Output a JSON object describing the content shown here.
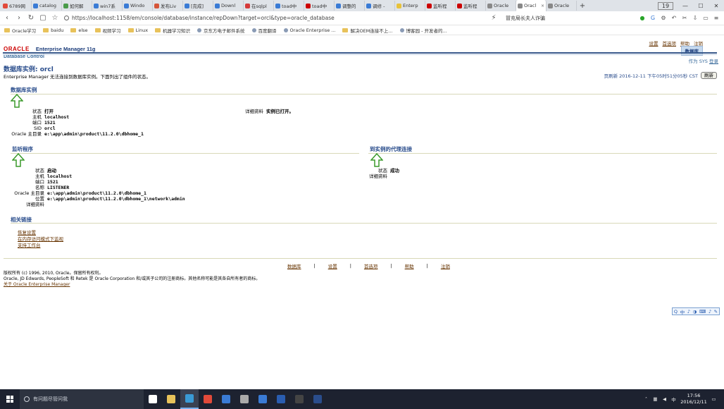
{
  "browser": {
    "tabs": [
      {
        "label": "6789网",
        "color": "#e24a3a",
        "active": false
      },
      {
        "label": "catalog",
        "color": "#3a7bd5",
        "active": false
      },
      {
        "label": "如何解",
        "color": "#4a9b4a",
        "active": false
      },
      {
        "label": "win7系",
        "color": "#3a7bd5",
        "active": false
      },
      {
        "label": "Windo",
        "color": "#3a7bd5",
        "active": false
      },
      {
        "label": "发布Liv",
        "color": "#d5553a",
        "active": false
      },
      {
        "label": "[完成]",
        "color": "#3a7bd5",
        "active": false
      },
      {
        "label": "Downl",
        "color": "#3a7bd5",
        "active": false
      },
      {
        "label": "在sqlpl",
        "color": "#d53a3a",
        "active": false
      },
      {
        "label": "toad中",
        "color": "#3a7bd5",
        "active": false
      },
      {
        "label": "toad中",
        "color": "#cc0000",
        "active": false
      },
      {
        "label": "调整的",
        "color": "#3a7bd5",
        "active": false
      },
      {
        "label": "调修 -",
        "color": "#3a7bd5",
        "active": false
      },
      {
        "label": "Enterp",
        "color": "#e8c23a",
        "active": false
      },
      {
        "label": "监听程",
        "color": "#cc0000",
        "active": false
      },
      {
        "label": "监听程",
        "color": "#cc0000",
        "active": false
      },
      {
        "label": "Oracle",
        "color": "#888888",
        "active": false
      },
      {
        "label": "Oracl",
        "color": "#888888",
        "active": true
      },
      {
        "label": "Oracle",
        "color": "#888888",
        "active": false
      }
    ],
    "tab_count": "19",
    "url": "https://localhost:1158/em/console/database/instance/repDown?target=orcl&type=oracle_database",
    "search_text": "冒充局长夫人诈骗",
    "bookmarks": [
      {
        "label": "Oracle学习",
        "folder": true
      },
      {
        "label": "baidu",
        "folder": true
      },
      {
        "label": "else",
        "folder": true
      },
      {
        "label": "视频学习",
        "folder": true
      },
      {
        "label": "Linux",
        "folder": true
      },
      {
        "label": "机器学习知识",
        "folder": true
      },
      {
        "label": "京东方电子邮件系统",
        "folder": false
      },
      {
        "label": "百度翻译",
        "folder": false
      },
      {
        "label": "Oracle Enterprise ...",
        "folder": false
      },
      {
        "label": "解决OEM连接不上...",
        "folder": true
      },
      {
        "label": "博客园 - 开发者的...",
        "folder": false
      }
    ]
  },
  "oem": {
    "logo_text": "ORACLE",
    "product_title": "Enterprise Manager 11g",
    "subtitle": "Database Control",
    "global_links": [
      "设置",
      "首选项",
      "帮助",
      "注销"
    ],
    "db_tab": "数据库",
    "logged_in_as_label": "作为",
    "logged_in_user": "SYS",
    "logout_label": "登录",
    "page_title": "数据库实例: orcl",
    "page_desc": "Enterprise Manager 无法连接到数据库实例。下面列出了组件的状态。",
    "refresh_time": "页刷新 2016-12-11 下午05时51分05秒 CST",
    "refresh_button": "刷新",
    "db_instance": {
      "heading": "数据库实例",
      "rows": [
        {
          "k": "状态",
          "v": "打开"
        },
        {
          "k": "主机",
          "v": "localhost"
        },
        {
          "k": "端口",
          "v": "1521"
        },
        {
          "k": "SID",
          "v": "orcl"
        },
        {
          "k": "Oracle 主目录",
          "v": "e:\\app\\admin\\product\\11.2.0\\dbhome_1"
        }
      ],
      "details_label": "详细资料",
      "details_value": "实例已打开。"
    },
    "listener": {
      "heading": "监听程序",
      "rows": [
        {
          "k": "状态",
          "v": "启动"
        },
        {
          "k": "主机",
          "v": "localhost"
        },
        {
          "k": "端口",
          "v": "1521"
        },
        {
          "k": "名称",
          "v": "LISTENER"
        },
        {
          "k": "Oracle 主目录",
          "v": "e:\\app\\admin\\product\\11.2.0\\dbhome_1"
        },
        {
          "k": "位置",
          "v": "e:\\app\\admin\\product\\11.2.0\\dbhome_1\\network\\admin"
        },
        {
          "k": "详细资料",
          "v": ""
        }
      ]
    },
    "agent": {
      "heading": "到实例的代理连接",
      "rows": [
        {
          "k": "状态",
          "v": "成功"
        },
        {
          "k": "详细资料",
          "v": ""
        }
      ]
    },
    "related_links": {
      "heading": "相关链接",
      "items": [
        "恢复设置",
        "在内存访问模式下监视",
        "支持工作台"
      ]
    },
    "footer_links": [
      "数据库",
      "设置",
      "首选项",
      "帮助",
      "注销"
    ],
    "footer_sep": "|",
    "copyright_lines": [
      "版权所有 (c) 1996, 2010, Oracle。保留所有权利。",
      "Oracle, JD Edwards, PeopleSoft 和 Retek 是 Oracle Corporation 和/或其子公司的注册商标。其他名称可能是其各自所有者的商标。"
    ],
    "about_link": "关于 Oracle Enterprise Manager",
    "arrow_color": "#3a9a2a"
  },
  "ime_bar": [
    "Q",
    "中",
    "♪",
    "◑",
    "⌨",
    "♪",
    "✎"
  ],
  "taskbar": {
    "search_placeholder": "有问题尽管问我",
    "apps": [
      {
        "name": "task-view",
        "color": "#ffffff",
        "active": false
      },
      {
        "name": "file-explorer",
        "color": "#e8c25a",
        "active": false
      },
      {
        "name": "browser",
        "color": "#3a9ad5",
        "active": true
      },
      {
        "name": "chrome",
        "color": "#e24a3a",
        "active": false
      },
      {
        "name": "store",
        "color": "#3a7bd5",
        "active": false
      },
      {
        "name": "settings",
        "color": "#aaaaaa",
        "active": false
      },
      {
        "name": "mail",
        "color": "#3a7bd5",
        "active": false
      },
      {
        "name": "app-blue",
        "color": "#2a5db0",
        "active": false
      },
      {
        "name": "terminal",
        "color": "#444444",
        "active": false
      },
      {
        "name": "toad",
        "color": "#2a4d8c",
        "active": false
      }
    ],
    "time": "17:56",
    "date": "2016/12/11"
  }
}
